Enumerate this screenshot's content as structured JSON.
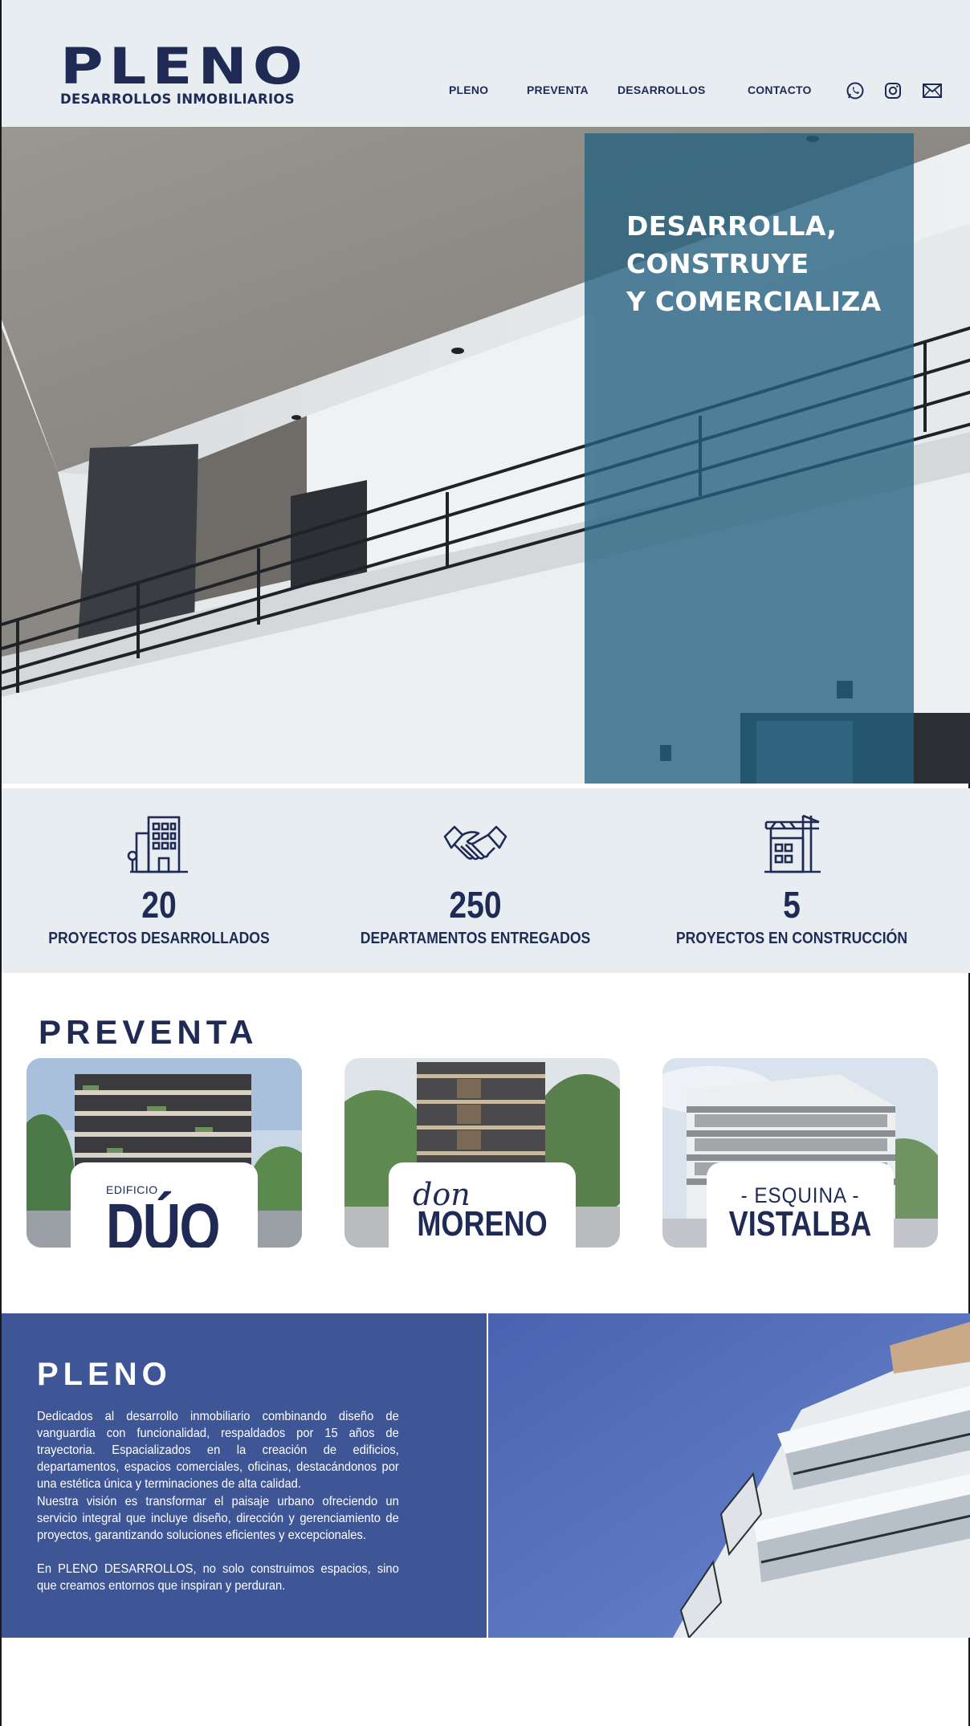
{
  "brand": {
    "name": "PLENO",
    "tagline": "DESARROLLOS INMOBILIARIOS"
  },
  "nav": {
    "items": [
      {
        "label": "PLENO"
      },
      {
        "label": "PREVENTA"
      },
      {
        "label": "DESARROLLOS"
      },
      {
        "label": "CONTACTO"
      }
    ],
    "icons": [
      "whatsapp-icon",
      "instagram-icon",
      "mail-icon"
    ]
  },
  "hero": {
    "lines": [
      "DESARROLLA,",
      "CONSTRUYE",
      "Y COMERCIALIZA"
    ]
  },
  "stats": [
    {
      "icon": "buildings-icon",
      "value": "20",
      "label": "PROYECTOS DESARROLLADOS"
    },
    {
      "icon": "handshake-icon",
      "value": "250",
      "label": "DEPARTAMENTOS ENTREGADOS"
    },
    {
      "icon": "crane-building-icon",
      "value": "5",
      "label": "PROYECTOS EN CONSTRUCCIÓN"
    }
  ],
  "preventa": {
    "title": "PREVENTA",
    "cards": [
      {
        "small": "EDIFICIO",
        "big": "DÚO"
      },
      {
        "script": "don",
        "big": "MORENO"
      },
      {
        "top": "- ESQUINA -",
        "big": "VISTALBA"
      }
    ]
  },
  "about": {
    "title": "PLENO",
    "paragraphs": [
      "Dedicados al desarrollo inmobiliario combinando diseño de vanguardia con funcionalidad, respaldados por 15 años de trayectoria. Espacializados en la creación de edificios, departamentos, espacios comerciales, oficinas, destacándonos por una estética única y terminaciones de alta calidad.",
      "Nuestra visión es transformar el paisaje urbano ofreciendo un servicio integral que incluye diseño, dirección y gerenciamiento de proyectos, garantizando soluciones eficientes y excepcionales.",
      "En PLENO DESARROLLOS, no solo construimos espacios, sino que creamos entornos que inspiran y perduran."
    ]
  },
  "colors": {
    "navy": "#1f2b55",
    "header_bg": "#e8edf2",
    "hero_overlay": "#246280",
    "about_bg": "#3e5596"
  }
}
